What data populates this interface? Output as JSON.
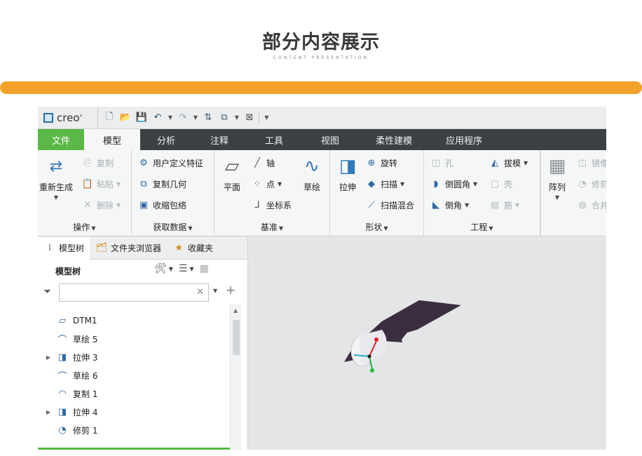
{
  "hero": {
    "title": "部分内容展示",
    "subtitle": "CONTENT PRESENTATION"
  },
  "colors": {
    "accent": "#f2a22a",
    "file_tab": "#5bb848",
    "tab_bar": "#3c4043",
    "icon_blue": "#2f6aa3",
    "model_fill": "#3a2e40"
  },
  "app": {
    "logo": "creo"
  },
  "quick_access": {
    "icons": [
      "new-file-icon",
      "open-folder-icon",
      "save-icon",
      "undo-icon",
      "redo-icon",
      "regenerate-icon",
      "window-icon",
      "close-icon",
      "customize-icon"
    ]
  },
  "tabs": [
    "文件",
    "模型",
    "分析",
    "注释",
    "工具",
    "视图",
    "柔性建模",
    "应用程序"
  ],
  "ribbon": {
    "operations": {
      "label": "操作",
      "regenerate": "重新生成",
      "copy": "复制",
      "paste": "粘贴",
      "delete": "删除"
    },
    "get_data": {
      "label": "获取数据",
      "udf": "用户定义特征",
      "copy_geom": "复制几何",
      "shrinkwrap": "收缩包络"
    },
    "datum": {
      "label": "基准",
      "plane": "平面",
      "axis": "轴",
      "point": "点",
      "csys": "坐标系",
      "sketch": "草绘"
    },
    "shapes": {
      "label": "形状",
      "extrude": "拉伸",
      "revolve": "旋转",
      "sweep": "扫描",
      "swept_blend": "扫描混合"
    },
    "engineering": {
      "label": "工程",
      "hole": "孔",
      "round": "倒圆角",
      "chamfer": "倒角",
      "draft": "拔模",
      "shell": "壳",
      "rib": "筋"
    },
    "editing": {
      "pattern": "阵列",
      "mirror": "镜像",
      "trim": "修剪",
      "merge": "合并"
    }
  },
  "panel": {
    "tabs": [
      "模型树",
      "文件夹浏览器",
      "收藏夹"
    ],
    "tree_title": "模型树",
    "search_placeholder": "",
    "items": [
      {
        "label": "DTM1",
        "icon": "datum-plane-icon",
        "expandable": false
      },
      {
        "label": "草绘 5",
        "icon": "sketch-icon",
        "expandable": false
      },
      {
        "label": "拉伸 3",
        "icon": "extrude-icon",
        "expandable": true
      },
      {
        "label": "草绘 6",
        "icon": "sketch-icon",
        "expandable": false
      },
      {
        "label": "复制 1",
        "icon": "copy-surface-icon",
        "expandable": false
      },
      {
        "label": "拉伸 4",
        "icon": "extrude-icon",
        "expandable": true
      },
      {
        "label": "修剪 1",
        "icon": "trim-icon",
        "expandable": false
      }
    ]
  }
}
